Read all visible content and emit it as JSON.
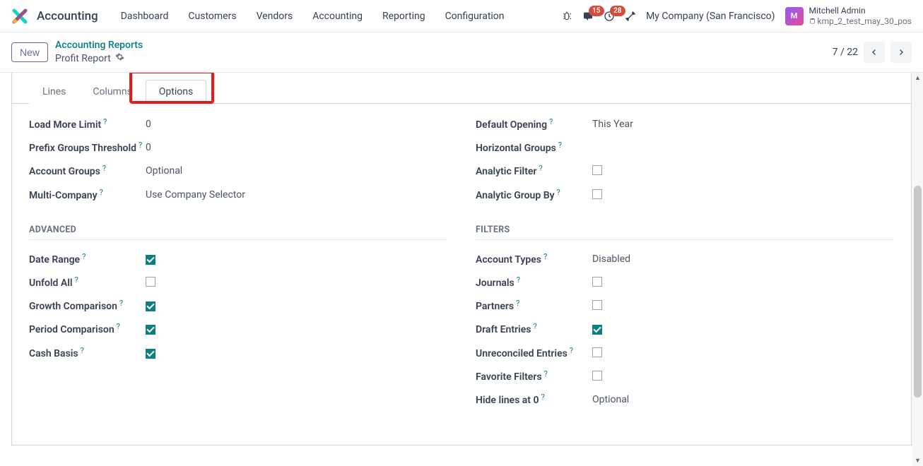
{
  "app_name": "Accounting",
  "nav": [
    "Dashboard",
    "Customers",
    "Vendors",
    "Accounting",
    "Reporting",
    "Configuration"
  ],
  "badges": {
    "messages": "15",
    "activities": "28"
  },
  "company": "My Company (San Francisco)",
  "user": {
    "name": "Mitchell Admin",
    "db": "kmp_2_test_may_30_pos"
  },
  "breadcrumb": {
    "parent": "Accounting Reports",
    "current": "Profit Report"
  },
  "button_new": "New",
  "pager": "7 / 22",
  "tabs": {
    "lines": "Lines",
    "columns": "Columns",
    "options": "Options"
  },
  "sections": {
    "advanced": "ADVANCED",
    "filters": "FILTERS"
  },
  "fields": {
    "load_more_limit": {
      "label": "Load More Limit",
      "value": "0"
    },
    "prefix_groups_threshold": {
      "label": "Prefix Groups Threshold",
      "value": "0"
    },
    "account_groups": {
      "label": "Account Groups",
      "value": "Optional"
    },
    "multi_company": {
      "label": "Multi-Company",
      "value": "Use Company Selector"
    },
    "default_opening": {
      "label": "Default Opening",
      "value": "This Year"
    },
    "horizontal_groups": {
      "label": "Horizontal Groups",
      "value": ""
    },
    "analytic_filter": {
      "label": "Analytic Filter"
    },
    "analytic_group_by": {
      "label": "Analytic Group By"
    },
    "date_range": {
      "label": "Date Range"
    },
    "unfold_all": {
      "label": "Unfold All"
    },
    "growth_comparison": {
      "label": "Growth Comparison"
    },
    "period_comparison": {
      "label": "Period Comparison"
    },
    "cash_basis": {
      "label": "Cash Basis"
    },
    "account_types": {
      "label": "Account Types",
      "value": "Disabled"
    },
    "journals": {
      "label": "Journals"
    },
    "partners": {
      "label": "Partners"
    },
    "draft_entries": {
      "label": "Draft Entries"
    },
    "unreconciled_entries": {
      "label": "Unreconciled Entries"
    },
    "favorite_filters": {
      "label": "Favorite Filters"
    },
    "hide_lines_at_0": {
      "label": "Hide lines at 0",
      "value": "Optional"
    }
  },
  "help_mark": "?"
}
